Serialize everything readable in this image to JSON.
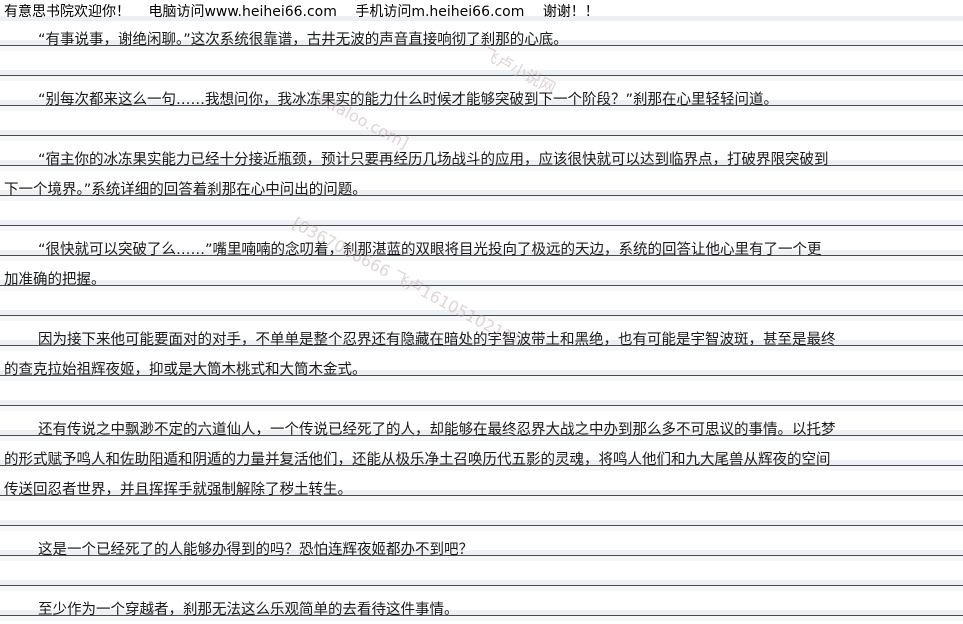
{
  "banner": {
    "welcome": "有意思书院欢迎你！",
    "pc": "电脑访问www.heihei66.com",
    "mobile": "手机访问m.heihei66.com",
    "thanks": "谢谢！！"
  },
  "lines": [
    {
      "text": "“有事说事，谢绝闲聊。”这次系统很靠谱，古井无波的声音直接响彻了刹那的心底。",
      "indent": true
    },
    {
      "text": "",
      "indent": false
    },
    {
      "text": "“别每次都来这么一句……我想问你，我冰冻果实的能力什么时候才能够突破到下一个阶段？”刹那在心里轻轻问道。",
      "indent": true
    },
    {
      "text": "",
      "indent": false
    },
    {
      "text": "“宿主你的冰冻果实能力已经十分接近瓶颈，预计只要再经历几场战斗的应用，应该很快就可以达到临界点，打破界限突破到",
      "indent": true
    },
    {
      "text": "下一个境界。”系统详细的回答着刹那在心中问出的问题。",
      "indent": false
    },
    {
      "text": "",
      "indent": false
    },
    {
      "text": "“很快就可以突破了么……”嘴里喃喃的念叨着，刹那湛蓝的双眼将目光投向了极远的天边，系统的回答让他心里有了一个更",
      "indent": true
    },
    {
      "text": "加准确的把握。",
      "indent": false
    },
    {
      "text": "",
      "indent": false
    },
    {
      "text": "因为接下来他可能要面对的对手，不单单是整个忍界还有隐藏在暗处的宇智波带土和黑绝，也有可能是宇智波斑，甚至是最终",
      "indent": true
    },
    {
      "text": "的查克拉始祖辉夜姬，抑或是大筒木桃式和大筒木金式。",
      "indent": false
    },
    {
      "text": "",
      "indent": false
    },
    {
      "text": "还有传说之中飘渺不定的六道仙人，一个传说已经死了的人，却能够在最终忍界大战之中办到那么多不可思议的事情。以托梦",
      "indent": true
    },
    {
      "text": "的形式赋予鸣人和佐助阳遁和阴遁的力量并复活他们，还能从极乐净土召唤历代五影的灵魂，将鸣人他们和九大尾兽从辉夜的空间",
      "indent": false
    },
    {
      "text": "传送回忍者世界，并且挥挥手就强制解除了秽土转生。",
      "indent": false
    },
    {
      "text": "",
      "indent": false
    },
    {
      "text": "这是一个已经死了的人能够办得到的吗？恐怕连辉夜姬都办不到吧？",
      "indent": true
    },
    {
      "text": "",
      "indent": false
    },
    {
      "text": "至少作为一个穿越者，刹那无法这么乐观简单的去看待这件事情。",
      "indent": true
    }
  ],
  "watermarks": [
    "飞卢小说网",
    "[b.faloo.com]",
    "[0367086666 飞卢1610510211]"
  ]
}
